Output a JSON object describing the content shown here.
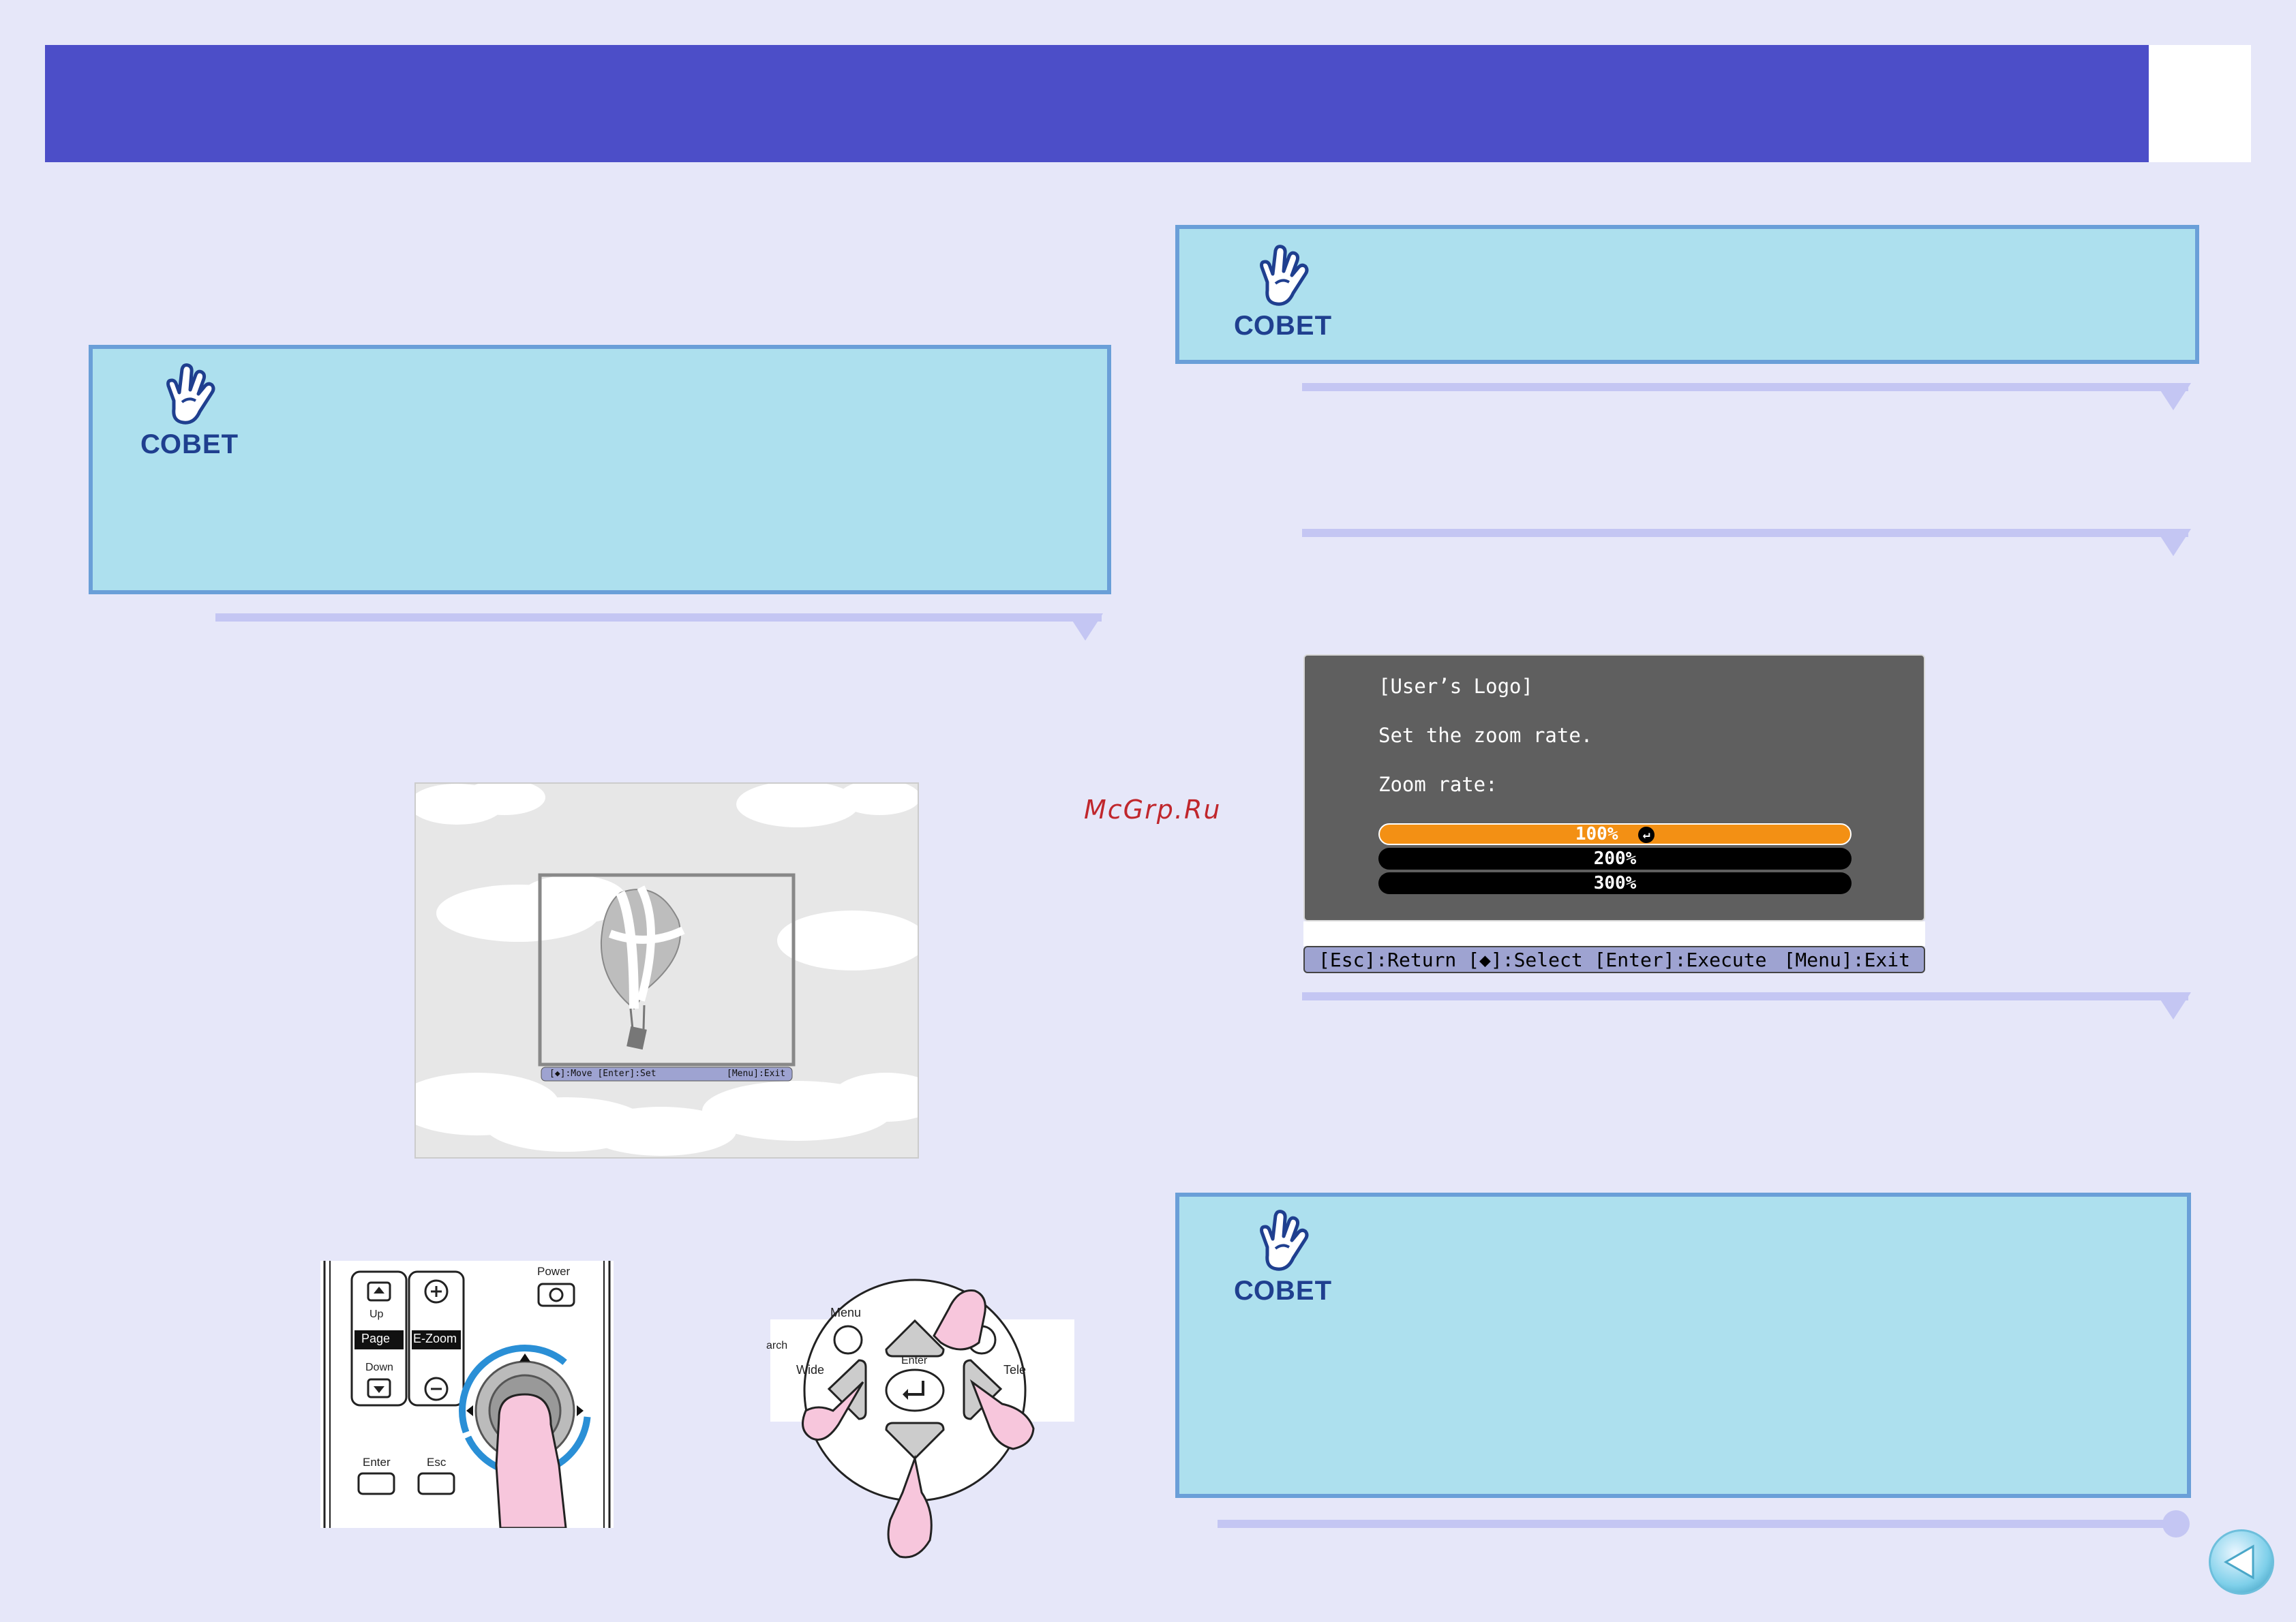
{
  "header": {
    "title": ""
  },
  "notes": [
    {
      "label": "СОВЕТ"
    },
    {
      "label": "СОВЕТ"
    },
    {
      "label": "СОВЕТ"
    }
  ],
  "watermark": "McGrp.Ru",
  "osd": {
    "title": "[User’s Logo]",
    "instruction": "Set the zoom rate.",
    "zoom_label": "Zoom rate:",
    "options": [
      "100%",
      "200%",
      "300%"
    ],
    "selected_index": 0,
    "help_left": "[Esc]:Return [◆]:Select [Enter]:Execute",
    "help_right": "[Menu]:Exit",
    "colors": {
      "panel": "#5f5f5f",
      "selected": "#f39014",
      "help_bar": "#9ea3d1"
    }
  },
  "photo": {
    "help_left": "[◆]:Move [Enter]:Set",
    "help_right": "[Menu]:Exit"
  },
  "remote": {
    "up": "Up",
    "page": "Page",
    "down": "Down",
    "ezoom": "E-Zoom",
    "power": "Power",
    "enter": "Enter",
    "esc": "Esc"
  },
  "control_panel": {
    "menu": "Menu",
    "wide": "Wide",
    "tele": "Tele",
    "enter": "Enter",
    "search_partial": "arch"
  },
  "colors": {
    "header": "#4c4ec8",
    "background": "#e6e7f9",
    "note_fill": "#ade0ee",
    "note_border": "#6a9fd8",
    "rule": "#c4c6f3"
  }
}
